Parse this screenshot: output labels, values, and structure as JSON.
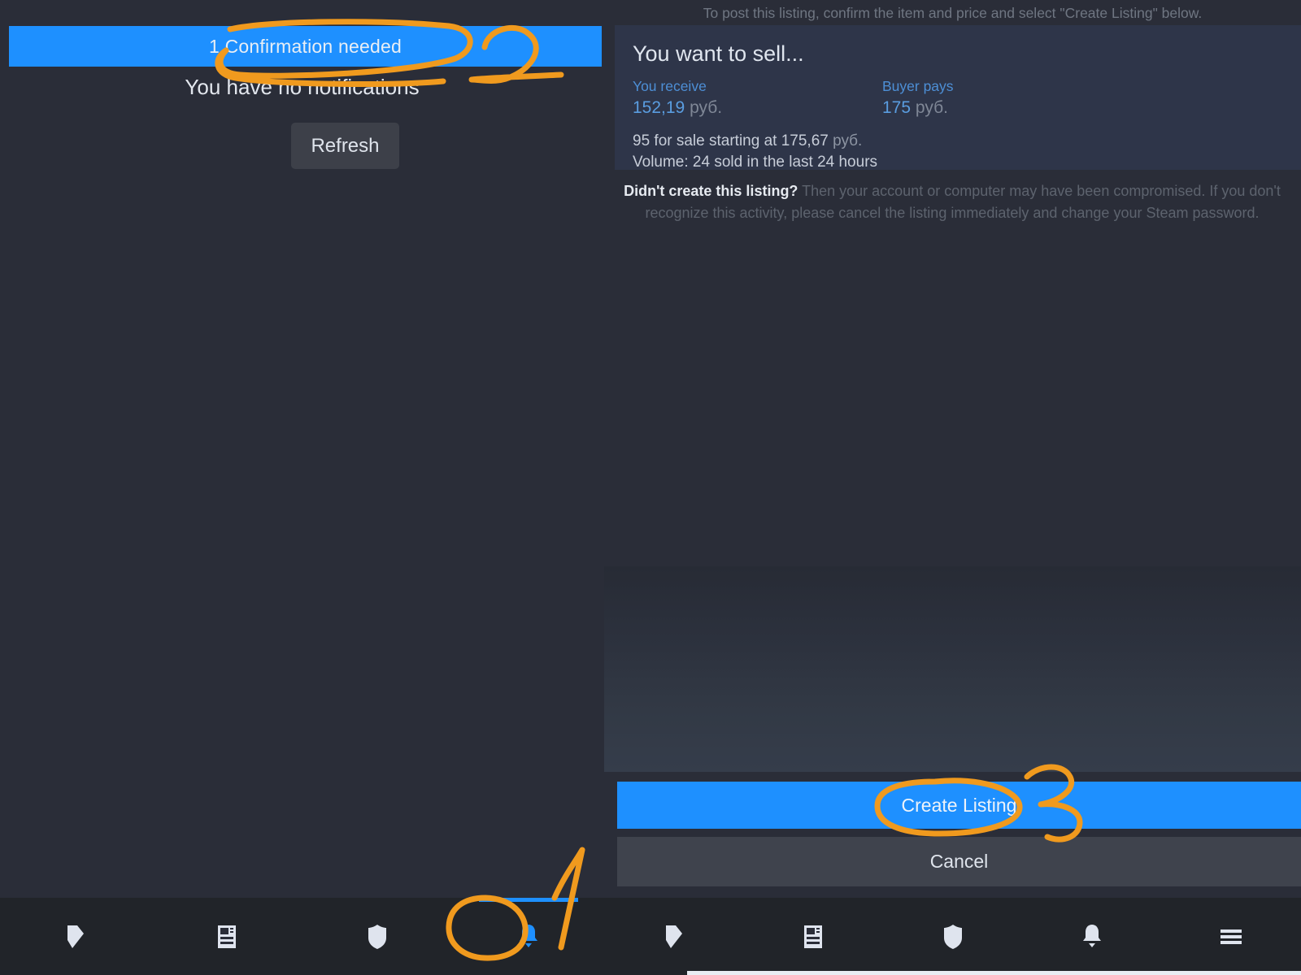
{
  "left_panel": {
    "confirmation_button": "1 Confirmation needed",
    "empty_state": "You have no notifications",
    "refresh_button": "Refresh"
  },
  "right_panel": {
    "post_hint": "To post this listing, confirm the item and price and select \"Create Listing\" below.",
    "sell_card": {
      "title": "You want to sell...",
      "you_receive_label": "You receive",
      "you_receive_amount": "152,19",
      "you_receive_currency": "руб.",
      "buyer_pays_label": "Buyer pays",
      "buyer_pays_amount": "175",
      "buyer_pays_currency": "руб.",
      "for_sale_line_prefix": "95 for sale starting at 175,67",
      "for_sale_currency": "руб.",
      "volume_line": "Volume: 24 sold in the last 24 hours"
    },
    "warning": {
      "bold": "Didn't create this listing?",
      "text": " Then your account or computer may have been compromised. If you don't recognize this activity, please cancel the listing immediately and change your Steam password."
    },
    "create_listing_button": "Create Listing",
    "cancel_button": "Cancel"
  },
  "nav_left": {
    "items": [
      {
        "icon": "tag-icon",
        "active": false
      },
      {
        "icon": "news-icon",
        "active": false
      },
      {
        "icon": "shield-icon",
        "active": false
      },
      {
        "icon": "bell-icon",
        "active": true
      }
    ]
  },
  "nav_right": {
    "items": [
      {
        "icon": "tag-icon",
        "active": false
      },
      {
        "icon": "news-icon",
        "active": false
      },
      {
        "icon": "shield-icon",
        "active": false
      },
      {
        "icon": "bell-icon",
        "active": false
      },
      {
        "icon": "hamburger-menu-icon",
        "active": false
      }
    ]
  },
  "annotations": {
    "color": "#f09a1e",
    "marks": [
      {
        "label": "1",
        "target": "bell-icon in left nav bar"
      },
      {
        "label": "2",
        "target": "1 Confirmation needed button"
      },
      {
        "label": "3",
        "target": "Create Listing button"
      }
    ]
  },
  "colors": {
    "background": "#2a2d38",
    "accent_blue": "#1e90ff",
    "card_background": "#2e3549",
    "navbar": "#212429",
    "annotation_orange": "#f09a1e"
  }
}
